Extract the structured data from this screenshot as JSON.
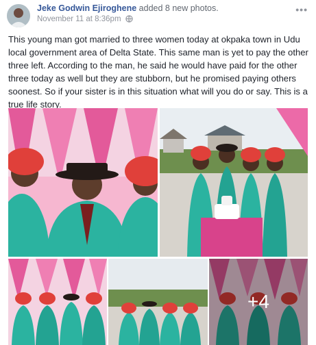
{
  "post": {
    "author": "Jeke Godwin Ejiroghene",
    "action": "added 8 new photos.",
    "timestamp": "November 11 at 8:36pm",
    "privacy_icon": "globe-icon",
    "menu_icon": "more-options-icon",
    "text": "This young man got married to three women today at okpaka town in Udu local government area of Delta State. This same man is yet to pay the other three left. According to the man, he said he would have paid for the other three today as well but they are stubborn, but he promised paying others soonest. So if your sister is in this situation what will you do or say. This is a true life story.",
    "more_photos_label": "+4"
  },
  "colors": {
    "link": "#365899",
    "meta": "#90949c",
    "text": "#1d2129",
    "lace_green": "#2bb3a0",
    "headwrap_red": "#e0403a",
    "tent_pink": "#ec6aa8"
  }
}
